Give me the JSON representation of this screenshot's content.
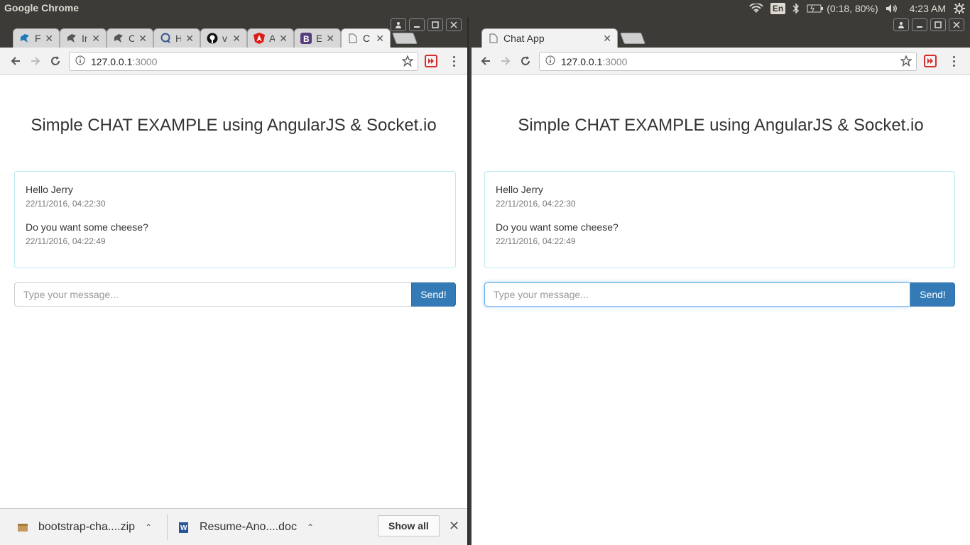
{
  "system": {
    "app_title": "Google Chrome",
    "keyboard": "En",
    "battery": "(0:18, 80%)",
    "clock": "4:23 AM"
  },
  "colors": {
    "primary": "#337ab7",
    "panel_border": "#bce8f1",
    "focus": "#66afe9"
  },
  "left_window": {
    "tabs": [
      {
        "label": "F",
        "icon": "bird-icon"
      },
      {
        "label": "In",
        "icon": "bird-icon"
      },
      {
        "label": "C",
        "icon": "bird-icon"
      },
      {
        "label": "H",
        "icon": "chat-bubble-icon"
      },
      {
        "label": "v",
        "icon": "github-icon"
      },
      {
        "label": "A",
        "icon": "angular-icon"
      },
      {
        "label": "E",
        "icon": "bootstrap-icon"
      },
      {
        "label": "C",
        "icon": "page-icon"
      }
    ],
    "url_host": "127.0.0.1",
    "url_port": ":3000",
    "downloads": [
      {
        "name": "bootstrap-cha....zip",
        "icon": "archive-icon"
      },
      {
        "name": "Resume-Ano....doc",
        "icon": "word-doc-icon"
      }
    ],
    "show_all": "Show all"
  },
  "right_window": {
    "tab_title": "Chat App",
    "url_host": "127.0.0.1",
    "url_port": ":3000"
  },
  "chat": {
    "heading": "Simple CHAT EXAMPLE using AngularJS & Socket.io",
    "messages": [
      {
        "text": "Hello Jerry",
        "time": "22/11/2016, 04:22:30"
      },
      {
        "text": "Do you want some cheese?",
        "time": "22/11/2016, 04:22:49"
      }
    ],
    "input_placeholder": "Type your message...",
    "send_label": "Send!"
  }
}
